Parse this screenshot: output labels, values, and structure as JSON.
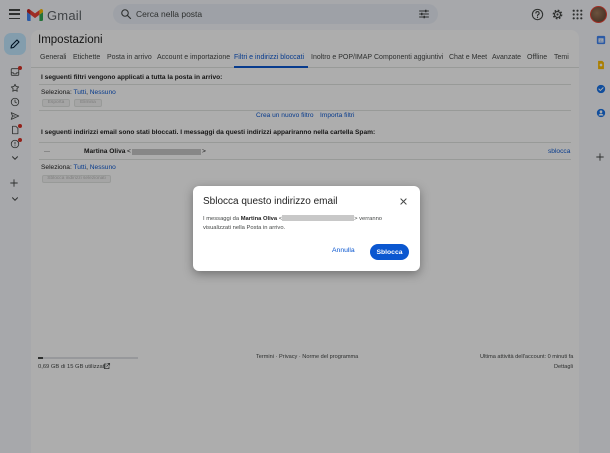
{
  "app": {
    "name": "Gmail"
  },
  "search": {
    "placeholder": "Cerca nella posta"
  },
  "settings": {
    "title": "Impostazioni",
    "tabs": [
      {
        "label": "Generali"
      },
      {
        "label": "Etichette"
      },
      {
        "label": "Posta in arrivo"
      },
      {
        "label": "Account e importazione"
      },
      {
        "label": "Filtri e indirizzi bloccati",
        "active": true
      },
      {
        "label": "Inoltro e POP/IMAP"
      },
      {
        "label": "Componenti aggiuntivi"
      },
      {
        "label": "Chat e Meet"
      },
      {
        "label": "Avanzate"
      },
      {
        "label": "Offline"
      },
      {
        "label": "Temi"
      }
    ],
    "filters": {
      "heading": "I seguenti filtri vengono applicati a tutta la posta in arrivo:",
      "select_label": "Seleziona:",
      "select_all": "Tutti",
      "select_none": "Nessuno",
      "export_button": "Esporta",
      "delete_button": "Elimina",
      "create_filter": "Crea un nuovo filtro",
      "import_filters": "Importa filtri"
    },
    "blocked": {
      "heading": "I seguenti indirizzi email sono stati bloccati. I messaggi da questi indirizzi appariranno nella cartella Spam:",
      "rows": [
        {
          "name": "Martina Oliva",
          "email_prefix": "<",
          "email_suffix": ">",
          "action": "sblocca"
        }
      ],
      "select_label": "Seleziona:",
      "select_all": "Tutti",
      "select_none": "Nessuno",
      "unblock_selected": "Sblocca indirizzi selezionati"
    }
  },
  "footer": {
    "storage": "0,69 GB di 15 GB utilizzati",
    "storage_fraction": 0.046,
    "links": "Termini · Privacy · Norme del programma",
    "last_activity": "Ultima attività dell'account: 0 minuti fa",
    "details": "Dettagli"
  },
  "dialog": {
    "title": "Sblocca questo indirizzo email",
    "body_prefix": "I messaggi da",
    "body_name": "Martina Oliva",
    "body_open": "<",
    "body_close": "> verranno",
    "body_line2": "visualizzati nella Posta in arrivo.",
    "cancel": "Annulla",
    "confirm": "Sblocca"
  },
  "colors": {
    "accent": "#0b57d0",
    "compose": "#c2e7ff",
    "notification": "#d93025"
  }
}
